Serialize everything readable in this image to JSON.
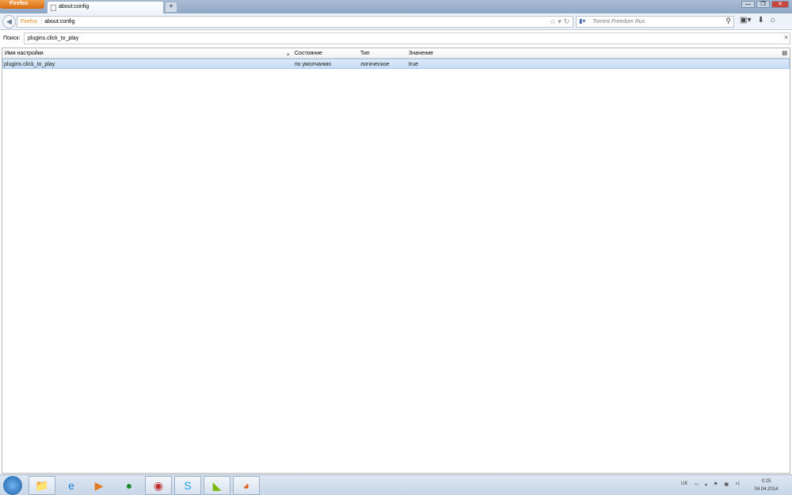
{
  "firefox_button": "Firefox",
  "tab": {
    "title": "about:config"
  },
  "window_buttons": {
    "minimize": "—",
    "restore": "❐",
    "close": "✕"
  },
  "url_bar": {
    "identity": "Firefox",
    "url": "about:config"
  },
  "search_bar": {
    "placeholder": "Torrent Freedom Rus"
  },
  "filter": {
    "label": "Поиск:",
    "value": "plugins.click_to_play"
  },
  "table": {
    "columns": [
      "Имя настройки",
      "Состояние",
      "Тип",
      "Значение"
    ],
    "rows": [
      {
        "name": "plugins.click_to_play",
        "status": "по умолчанию",
        "type": "логическое",
        "value": "true"
      }
    ]
  },
  "taskbar": {
    "apps": [
      "explorer",
      "internet-explorer",
      "media-player",
      "app-green",
      "app-red",
      "skype",
      "nvidia",
      "firefox"
    ]
  },
  "tray": {
    "language": "UK",
    "time": "0:25",
    "date": "04.04.2014"
  }
}
